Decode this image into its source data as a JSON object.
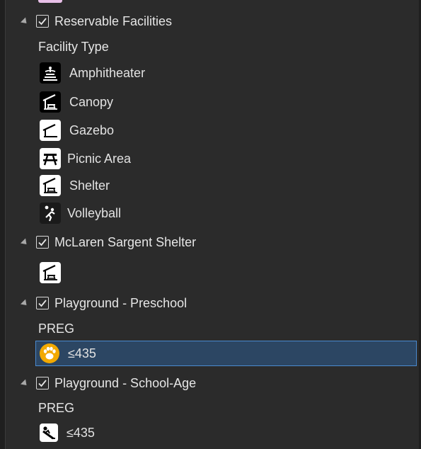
{
  "colors": {
    "background": "#2b2b2b",
    "text": "#e2e2e2",
    "selection_bg": "#2c4663",
    "selection_border": "#4a8ad0",
    "playground_symbol": "#f2a900"
  },
  "layers": [
    {
      "name": "Reservable Facilities",
      "checked": true,
      "field": "Facility Type",
      "classes": [
        {
          "label": "Amphitheater",
          "icon": "amphitheater-icon"
        },
        {
          "label": "Canopy",
          "icon": "canopy-icon"
        },
        {
          "label": "Gazebo",
          "icon": "gazebo-icon"
        },
        {
          "label": "Picnic Area",
          "icon": "picnic-table-icon"
        },
        {
          "label": "Shelter",
          "icon": "shelter-icon"
        },
        {
          "label": "Volleyball",
          "icon": "volleyball-icon"
        }
      ]
    },
    {
      "name": "McLaren Sargent Shelter",
      "checked": true,
      "classes": [
        {
          "label": "",
          "icon": "shelter-icon"
        }
      ]
    },
    {
      "name": "Playground - Preschool",
      "checked": true,
      "field": "PREG",
      "classes": [
        {
          "label": "≤435",
          "icon": "paw-icon",
          "selected": true
        }
      ]
    },
    {
      "name": "Playground - School-Age",
      "checked": true,
      "field": "PREG",
      "classes": [
        {
          "label": "≤435",
          "icon": "slide-icon"
        }
      ]
    }
  ]
}
